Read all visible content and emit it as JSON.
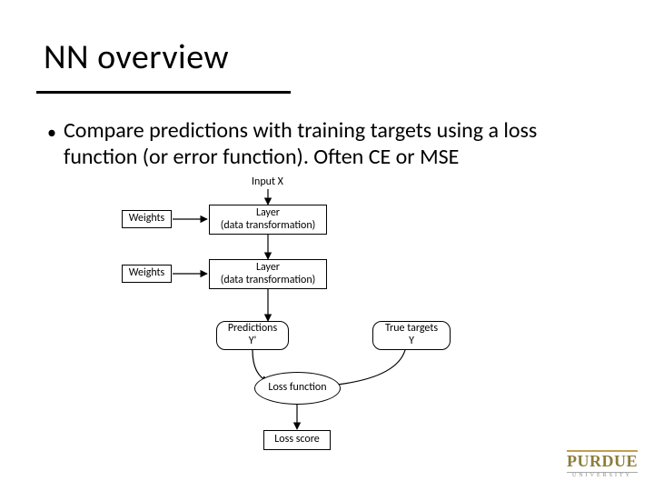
{
  "title": "NN overview",
  "bullet": "Compare predictions with training targets using a loss function (or error function).  Often CE or MSE",
  "diagram": {
    "input_label": "Input X",
    "weights_label": "Weights",
    "layer_label": "Layer\n(data transformation)",
    "predictions_label": "Predictions\nY'",
    "true_targets_label": "True targets\nY",
    "loss_fn_label": "Loss function",
    "loss_score_label": "Loss score"
  },
  "logo": {
    "main": "PURDUE",
    "sub": "UNIVERSITY"
  }
}
